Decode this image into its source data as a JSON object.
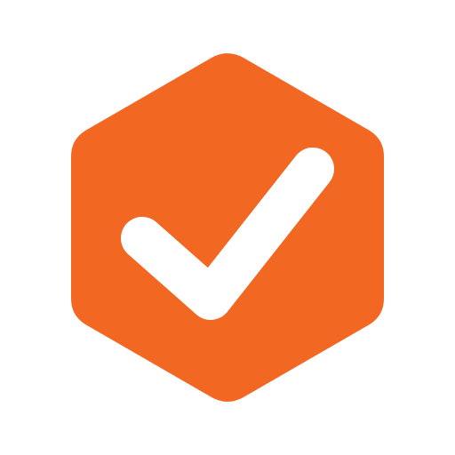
{
  "icon": {
    "name": "hexagon-checkmark-icon",
    "hexagon_color": "#F26722",
    "check_color": "#FFFFFF",
    "background_color": "#FFFFFF"
  }
}
